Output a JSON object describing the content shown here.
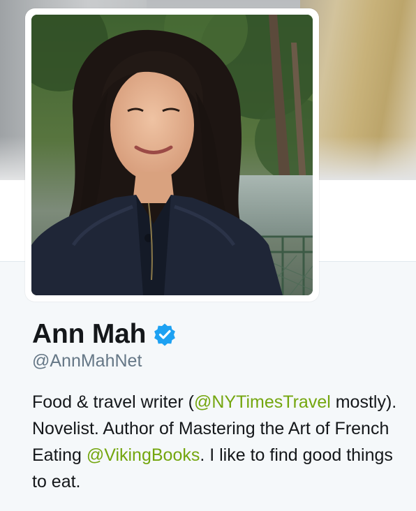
{
  "profile": {
    "name": "Ann Mah",
    "verified": true,
    "handle": "@AnnMahNet",
    "bio": {
      "part1": "Food & travel writer (",
      "mention1": "@NYTimesTravel",
      "part2": " mostly). Novelist. Author of Mastering the Art of French Eating ",
      "mention2": "@VikingBooks",
      "part3": ". I like to find good things to eat."
    }
  },
  "icons": {
    "verified": "verified-badge-icon"
  },
  "colors": {
    "link": "#74a60f",
    "verified": "#1da1f2",
    "name": "#14171a",
    "handle": "#657786",
    "profile_background": "#f5f8fa"
  }
}
